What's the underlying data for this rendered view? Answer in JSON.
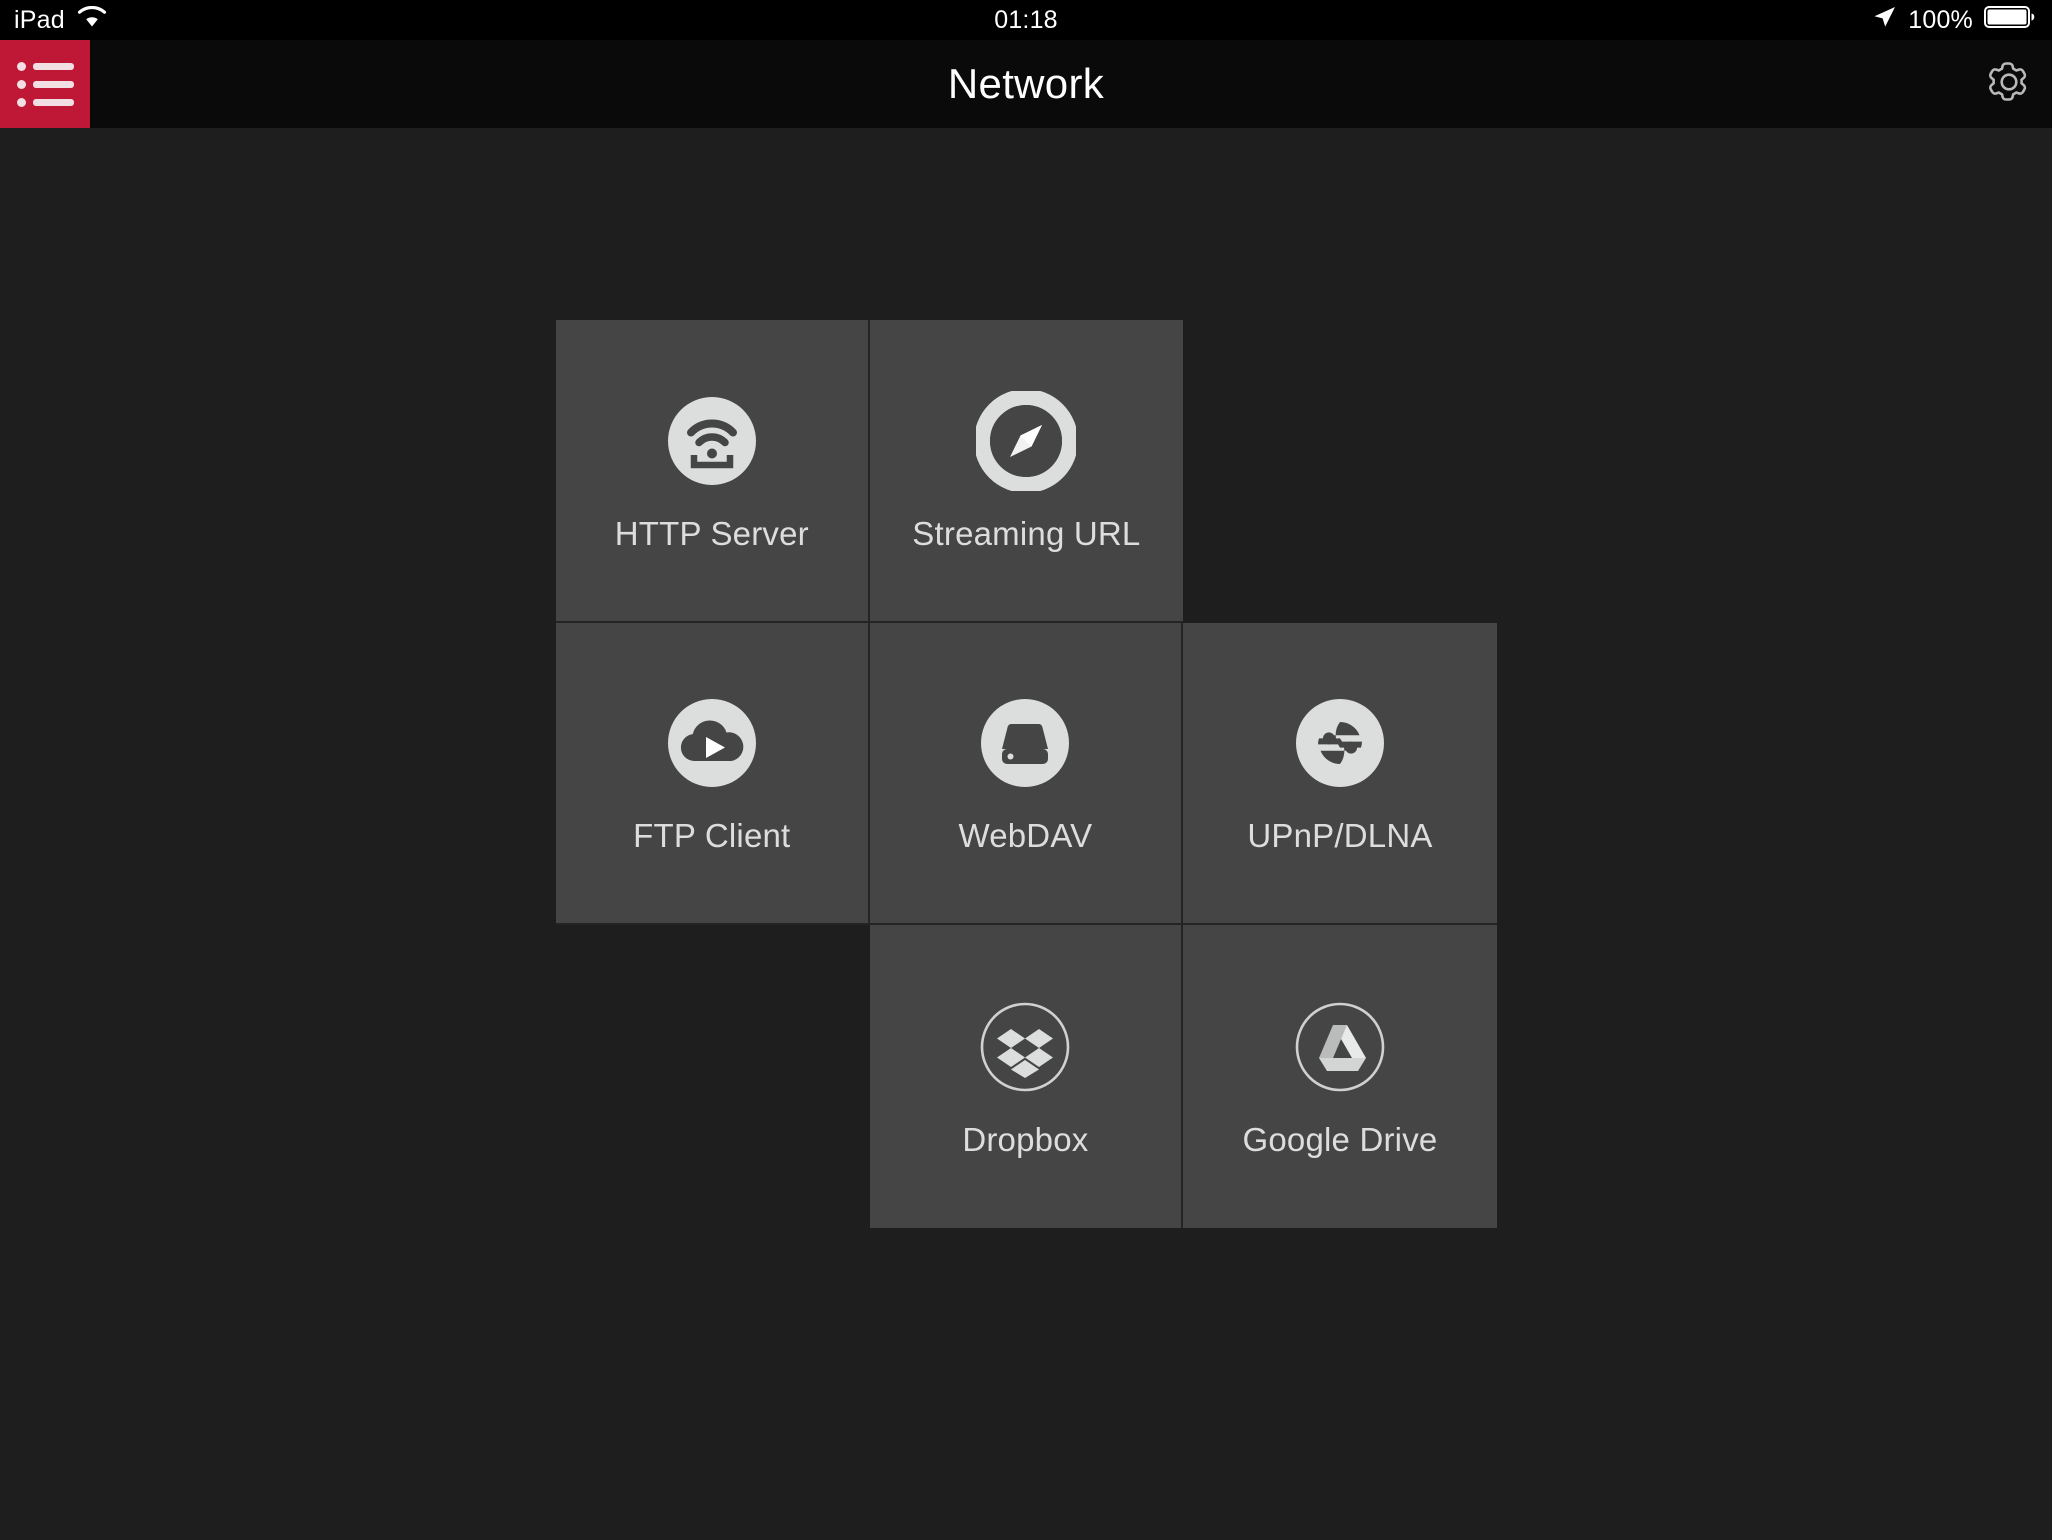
{
  "statusbar": {
    "device": "iPad",
    "wifi_icon": "wifi-icon",
    "time": "01:18",
    "location_icon": "location-arrow-icon",
    "battery_percent": "100%",
    "battery_icon": "battery-full-icon"
  },
  "navbar": {
    "title": "Network",
    "menu_icon": "hamburger-list-icon",
    "settings_icon": "gear-icon",
    "menu_color": "#bf1736"
  },
  "colors": {
    "background": "#1e1e1e",
    "tile": "#454545",
    "tile_divider": "#242424",
    "icon_fill": "#dcdedd",
    "label": "#dddddd",
    "accent_red": "#bf1736"
  },
  "grid": {
    "tiles": [
      {
        "label": "HTTP Server",
        "icon": "wifi-router-icon",
        "style": "solid-circle",
        "row": 1,
        "col": 1
      },
      {
        "label": "Streaming URL",
        "icon": "compass-icon",
        "style": "ring-circle",
        "row": 1,
        "col": 2
      },
      {
        "label": "",
        "icon": "",
        "style": "empty",
        "row": 1,
        "col": 3
      },
      {
        "label": "FTP Client",
        "icon": "cloud-play-icon",
        "style": "solid-circle",
        "row": 2,
        "col": 1
      },
      {
        "label": "WebDAV",
        "icon": "hard-drive-icon",
        "style": "solid-circle",
        "row": 2,
        "col": 2
      },
      {
        "label": "UPnP/DLNA",
        "icon": "network-share-icon",
        "style": "solid-circle",
        "row": 2,
        "col": 3
      },
      {
        "label": "",
        "icon": "",
        "style": "empty",
        "row": 3,
        "col": 1
      },
      {
        "label": "Dropbox",
        "icon": "dropbox-icon",
        "style": "outline-circle",
        "row": 3,
        "col": 2
      },
      {
        "label": "Google Drive",
        "icon": "google-drive-icon",
        "style": "outline-circle",
        "row": 3,
        "col": 3
      }
    ]
  }
}
